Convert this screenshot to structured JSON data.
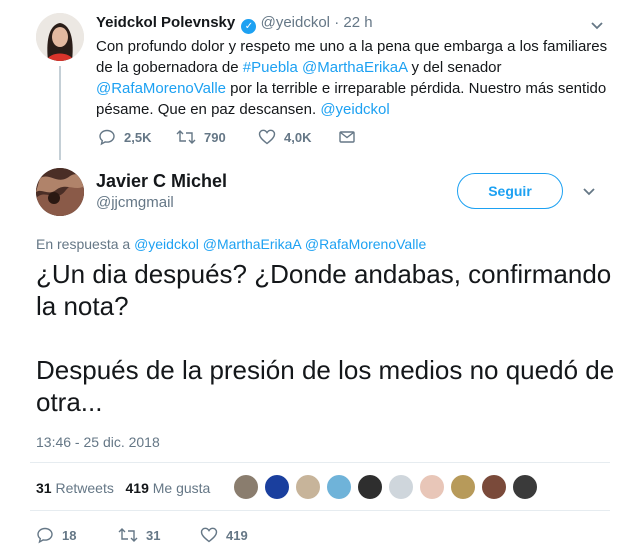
{
  "parent_tweet": {
    "name": "Yeidckol Polevnsky",
    "handle": "@yeidckol",
    "separator": "·",
    "time": "22 h",
    "text_parts": [
      {
        "t": "Con profundo dolor y respeto me uno a la pena que embarga a los familiares de la gobernadora de ",
        "link": false
      },
      {
        "t": "#Puebla",
        "link": true
      },
      {
        "t": " ",
        "link": false
      },
      {
        "t": "@MarthaErikaA",
        "link": true
      },
      {
        "t": " y del senador ",
        "link": false
      },
      {
        "t": "@RafaMorenoValle",
        "link": true
      },
      {
        "t": " por la terrible e irreparable pérdida. Nuestro más sentido pésame. Que en paz descansen. ",
        "link": false
      },
      {
        "t": "@yeidckol",
        "link": true
      }
    ],
    "replies": "2,5K",
    "retweets": "790",
    "likes": "4,0K"
  },
  "main_tweet": {
    "name": "Javier C Michel",
    "handle": "@jjcmgmail",
    "follow_label": "Seguir",
    "reply_prefix": "En respuesta a",
    "reply_mentions": "@yeidckol @MarthaErikaA @RafaMorenoValle",
    "paragraphs": [
      "¿Un dia después? ¿Donde andabas, confirmando la nota?",
      "Después de la presión de los medios no quedó de otra..."
    ],
    "timestamp": "13:46 - 25 dic. 2018",
    "retweet_count": "31",
    "retweet_label": "Retweets",
    "like_count": "419",
    "like_label": "Me gusta",
    "replies": "18",
    "retweets": "31",
    "likes": "419"
  },
  "colors": {
    "accent": "#1da1f2",
    "muted": "#657786",
    "text": "#14171a",
    "line": "#e6ecf0"
  },
  "likers": [
    {
      "color": "#8a7d6e"
    },
    {
      "color": "#1a3f9e"
    },
    {
      "color": "#c7b49a"
    },
    {
      "color": "#6fb3d9"
    },
    {
      "color": "#2e2e2e"
    },
    {
      "color": "#cfd6dc"
    },
    {
      "color": "#e8c6b8"
    },
    {
      "color": "#b79a5a"
    },
    {
      "color": "#7a4a3a"
    },
    {
      "color": "#3a3a3a"
    }
  ]
}
